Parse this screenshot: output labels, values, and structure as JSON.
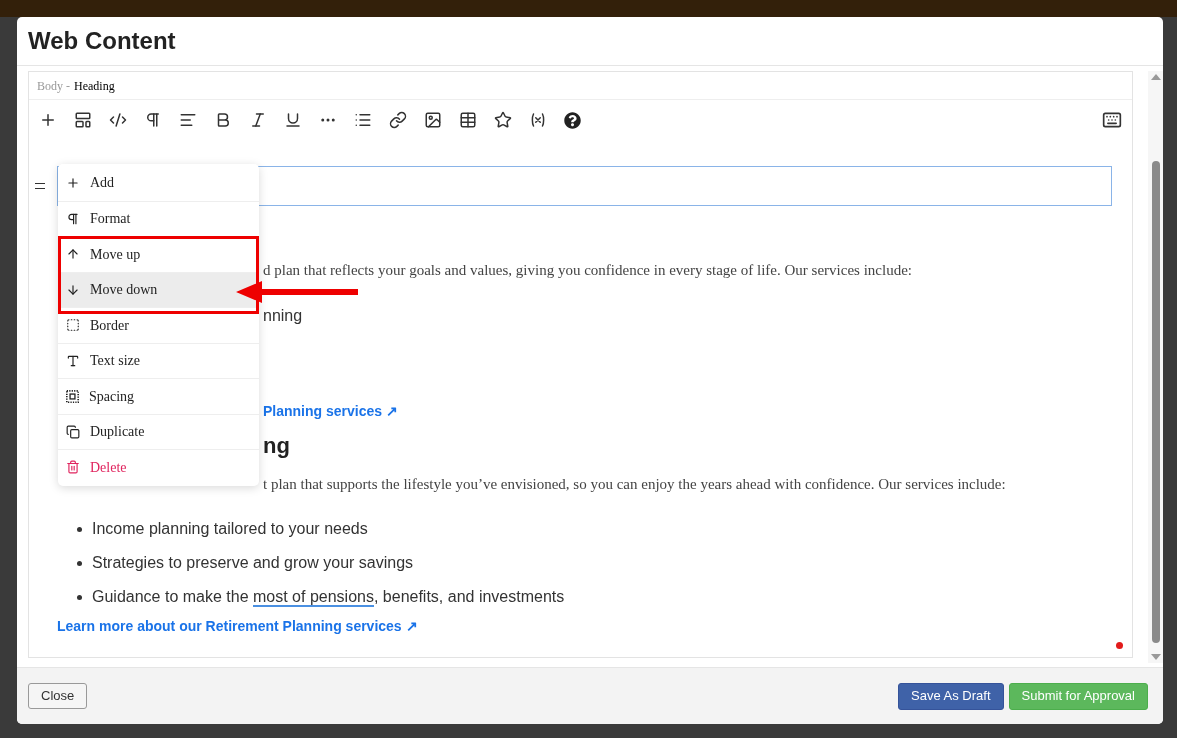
{
  "modal": {
    "title": "Web Content"
  },
  "editor": {
    "breadcrumb": [
      {
        "text": "Body -",
        "selected": false
      },
      {
        "text": "Heading",
        "selected": true
      }
    ],
    "blocks": [
      {
        "kind": "field"
      },
      {
        "kind": "paragraph",
        "covered": true,
        "text": "d plan that reflects your goals and values, giving you confidence in every stage of life. Our services include:"
      },
      {
        "kind": "fragment",
        "covered": true,
        "text": "nning"
      },
      {
        "kind": "link",
        "covered": true,
        "text": "Planning services ↗"
      },
      {
        "kind": "heading",
        "covered": true,
        "text": "ng"
      },
      {
        "kind": "paragraph",
        "covered": true,
        "text": "t plan that supports the lifestyle you’ve envisioned, so you can enjoy the years ahead with confidence. Our services include:"
      },
      {
        "kind": "bullets",
        "items": [
          {
            "segments": [
              {
                "text": "Income planning tailored to your needs",
                "underlined": false
              }
            ]
          },
          {
            "segments": [
              {
                "text": "Strategies to preserve and grow your savings",
                "underlined": false
              }
            ]
          },
          {
            "segments": [
              {
                "text": "Guidance to make the ",
                "underlined": false
              },
              {
                "text": "most of pensions",
                "underlined": true
              },
              {
                "text": ", benefits, and investments",
                "underlined": false
              }
            ]
          }
        ]
      },
      {
        "kind": "link",
        "text": "Learn more about our Retirement Planning services ↗"
      }
    ]
  },
  "context_menu": {
    "items": [
      {
        "kind": "add",
        "label": "Add",
        "selected": false
      },
      {
        "kind": "format",
        "label": "Format",
        "selected": false
      },
      {
        "kind": "move-up",
        "label": "Move up",
        "selected": false
      },
      {
        "kind": "move-down",
        "label": "Move down",
        "selected": true
      },
      {
        "kind": "border",
        "label": "Border",
        "selected": false
      },
      {
        "kind": "text-size",
        "label": "Text size",
        "selected": false
      },
      {
        "kind": "spacing",
        "label": "Spacing",
        "selected": false
      },
      {
        "kind": "duplicate",
        "label": "Duplicate",
        "selected": false
      },
      {
        "kind": "delete",
        "label": "Delete",
        "selected": false
      }
    ]
  },
  "footer": {
    "buttons": [
      {
        "kind": "default",
        "label": "Close"
      },
      {
        "kind": "primary",
        "label": "Save As Draft"
      },
      {
        "kind": "success",
        "label": "Submit for Approval"
      }
    ]
  }
}
